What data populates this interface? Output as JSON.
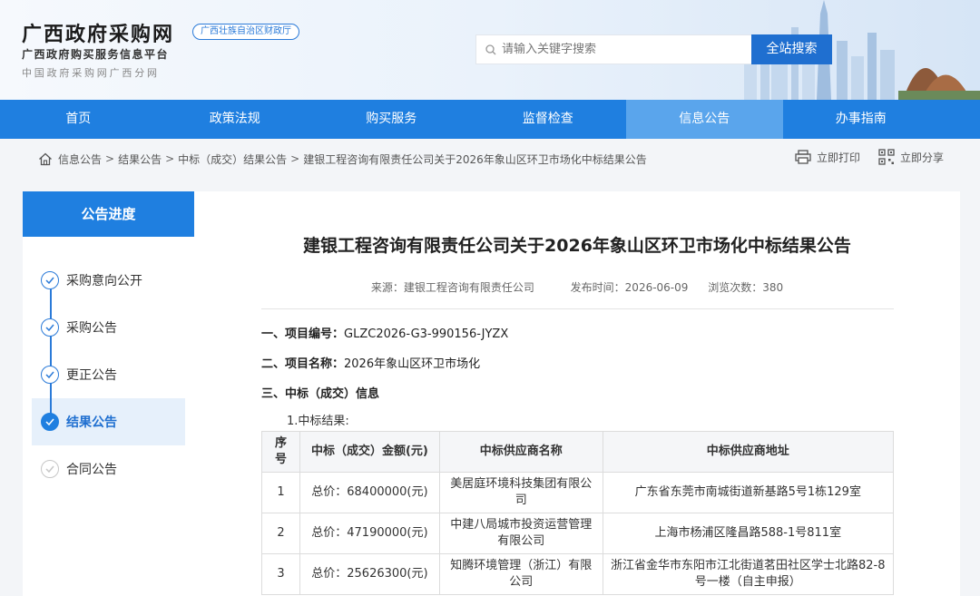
{
  "header": {
    "site_title": "广西政府采购网",
    "badge": "广西壮族自治区财政厅",
    "subtitle1": "广西政府购买服务信息平台",
    "subtitle2": "中国政府采购网广西分网",
    "search_placeholder": "请输入关键字搜索",
    "search_button": "全站搜索"
  },
  "nav": {
    "items": [
      "首页",
      "政策法规",
      "购买服务",
      "监督检查",
      "信息公告",
      "办事指南"
    ],
    "active_index": 4
  },
  "breadcrumb": {
    "items": [
      "信息公告",
      "结果公告",
      "中标（成交）结果公告",
      "建银工程咨询有限责任公司关于2026年象山区环卫市场化中标结果公告"
    ],
    "separator": ">"
  },
  "tools": {
    "print": "立即打印",
    "share": "立即分享"
  },
  "sidebar": {
    "title": "公告进度",
    "steps": [
      {
        "label": "采购意向公开",
        "state": "done"
      },
      {
        "label": "采购公告",
        "state": "done"
      },
      {
        "label": "更正公告",
        "state": "done"
      },
      {
        "label": "结果公告",
        "state": "current"
      },
      {
        "label": "合同公告",
        "state": "todo"
      }
    ]
  },
  "article": {
    "title": "建银工程咨询有限责任公司关于2026年象山区环卫市场化中标结果公告",
    "source": "来源：建银工程咨询有限责任公司",
    "publish_time": "发布时间：2026-06-09",
    "views": "浏览次数：380",
    "sections": [
      {
        "heading": "一、项目编号：",
        "value": "GLZC2026-G3-990156-JYZX"
      },
      {
        "heading": "二、项目名称：",
        "value": "2026年象山区环卫市场化"
      },
      {
        "heading": "三、中标（成交）信息",
        "value": ""
      }
    ],
    "subheading": "1.中标结果:",
    "table": {
      "headers": [
        "序号",
        "中标（成交）金额(元)",
        "中标供应商名称",
        "中标供应商地址"
      ],
      "rows": [
        [
          "1",
          "总价：68400000(元)",
          "美居庭环境科技集团有限公司",
          "广东省东莞市南城街道新基路5号1栋129室"
        ],
        [
          "2",
          "总价：47190000(元)",
          "中建八局城市投资运营管理有限公司",
          "上海市杨浦区隆昌路588-1号811室"
        ],
        [
          "3",
          "总价：25626300(元)",
          "知腾环境管理（浙江）有限公司",
          "浙江省金华市东阳市江北街道茗田社区学士北路82-8号一楼（自主申报）"
        ]
      ]
    }
  },
  "colors": {
    "brand_blue": "#1f7fe0",
    "active_nav": "#5aa5ec"
  }
}
